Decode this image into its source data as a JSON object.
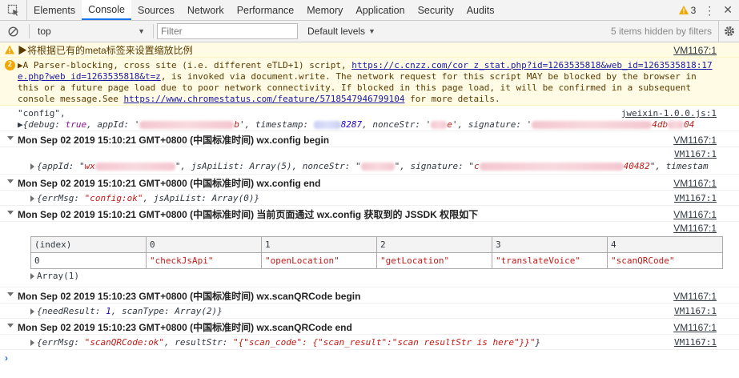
{
  "tabs": [
    {
      "label": "Elements"
    },
    {
      "label": "Console",
      "active": true
    },
    {
      "label": "Sources"
    },
    {
      "label": "Network"
    },
    {
      "label": "Performance"
    },
    {
      "label": "Memory"
    },
    {
      "label": "Application"
    },
    {
      "label": "Security"
    },
    {
      "label": "Audits"
    }
  ],
  "warning_count": "3",
  "toolbar": {
    "context": "top",
    "filter_placeholder": "Filter",
    "levels": "Default levels",
    "hidden_text": "5 items hidden by filters"
  },
  "colors": {
    "accent": "#1a73e8",
    "warn_bg": "#fffbe5",
    "string": "#c41a16",
    "number": "#1c00cf",
    "keyword": "#881391"
  },
  "messages": {
    "warn1": {
      "text": "▶将根据已有的meta标签来设置缩放比例",
      "source": "VM1167:1"
    },
    "warn2": {
      "count": "2",
      "pre": "▶A Parser-blocking, cross site (i.e. different eTLD+1) script, ",
      "link1_a": "https://c.cnzz.com/cor z_stat.php?id=1263535818&web_id=1263535818:17",
      "link1_b": "e.php?web id=1263535818&t=z",
      "mid": ", is invoked via document.write. The network request for this script MAY be blocked by the browser in",
      "line3": "this or a future page load due to poor network connectivity. If blocked in this page load, it will be confirmed in a subsequent",
      "line4_pre": "console message.See ",
      "link2": "https://www.chromestatus.com/feature/5718547946799104",
      "line4_post": " for more details."
    },
    "config_log": {
      "label": "\"config\",",
      "source": "jweixin-1.0.0.js:1",
      "obj_pre": "▶{debug: ",
      "debug": "true",
      "appid": ", appId: '",
      "appid_tail": "b",
      "timestamp": "', timestamp: ",
      "timestamp_tail": "8287",
      "nonce": ", nonceStr: '",
      "nonce_tail": "e",
      "signature": "', signature: '",
      "sig_tail": "4db",
      "sig_end": "04"
    },
    "g1": {
      "title": "Mon Sep 02 2019 15:10:21 GMT+0800 (中国标准时间) wx.config begin",
      "source": "VM1167:1",
      "obj_a": "{appId: \"",
      "appid_pre": "wx",
      "obj_b": "\", jsApiList: ",
      "array5": "Array(5)",
      "obj_c": ", nonceStr: \"",
      "obj_d": "\", signature: \"",
      "sig_pre": "c",
      "sig_tail": "40482",
      "obj_e": "\", timestam",
      "source2": "VM1167:1"
    },
    "g2": {
      "title": "Mon Sep 02 2019 15:10:21 GMT+0800 (中国标准时间) wx.config end",
      "source": "VM1167:1",
      "obj_a": "{errMsg: ",
      "errmsg": "\"config:ok\"",
      "obj_b": ", jsApiList: ",
      "array0": "Array(0)",
      "obj_c": "}",
      "source2": "VM1167:1"
    },
    "g3": {
      "title": "Mon Sep 02 2019 15:10:21 GMT+0800 (中国标准时间) 当前页面通过 wx.config 获取到的 JSSDK 权限如下",
      "source": "VM1167:1",
      "source2": "VM1167:1",
      "table": {
        "headers": [
          "(index)",
          "0",
          "1",
          "2",
          "3",
          "4"
        ],
        "rows": [
          [
            "0",
            "\"checkJsApi\"",
            "\"openLocation\"",
            "\"getLocation\"",
            "\"translateVoice\"",
            "\"scanQRCode\""
          ]
        ]
      },
      "array_label": "Array(1)"
    },
    "g4": {
      "title": "Mon Sep 02 2019 15:10:23 GMT+0800 (中国标准时间) wx.scanQRCode begin",
      "source": "VM1167:1",
      "obj_a": "{needResult: ",
      "needresult": "1",
      "obj_b": ", scanType: ",
      "array2": "Array(2)",
      "obj_c": "}",
      "source2": "VM1167:1"
    },
    "g5": {
      "title": "Mon Sep 02 2019 15:10:23 GMT+0800 (中国标准时间) wx.scanQRCode end",
      "source": "VM1167:1",
      "obj_a": "{errMsg: ",
      "errmsg": "\"scanQRCode:ok\"",
      "obj_b": ", resultStr: ",
      "result": "\"{\"scan_code\": {\"scan_result\":\"scan resultStr is here\"}}\"",
      "obj_c": "}",
      "source2": "VM1167:1"
    }
  },
  "prompt": "›"
}
